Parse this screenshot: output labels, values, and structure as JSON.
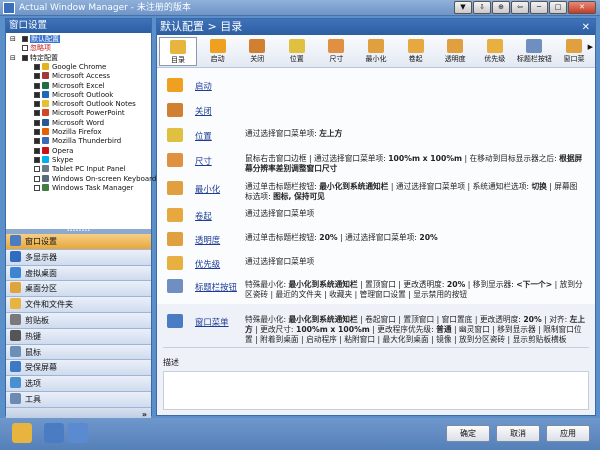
{
  "window": {
    "title": "Actual Window Manager - 未注册的版本",
    "buttons": [
      "▼",
      "⇩",
      "⊕",
      "⇦",
      "─",
      "□",
      "✕"
    ]
  },
  "left": {
    "header": "窗口设置",
    "tree": [
      {
        "label": "默认配置",
        "checked": true,
        "selected": true,
        "indent": 1
      },
      {
        "label": "忽略项",
        "checked": false,
        "indent": 1,
        "red": true
      },
      {
        "label": "特定配置",
        "checked": true,
        "indent": 1
      },
      {
        "label": "Google Chrome",
        "checked": true,
        "indent": 2,
        "color": "#e3b21f"
      },
      {
        "label": "Microsoft Access",
        "checked": true,
        "indent": 2,
        "color": "#a4373a"
      },
      {
        "label": "Microsoft Excel",
        "checked": true,
        "indent": 2,
        "color": "#1d7044"
      },
      {
        "label": "Microsoft Outlook",
        "checked": true,
        "indent": 2,
        "color": "#1b6bb8"
      },
      {
        "label": "Microsoft Outlook Notes",
        "checked": true,
        "indent": 2,
        "color": "#e5c030"
      },
      {
        "label": "Microsoft PowerPoint",
        "checked": true,
        "indent": 2,
        "color": "#d24726"
      },
      {
        "label": "Microsoft Word",
        "checked": true,
        "indent": 2,
        "color": "#2b5797"
      },
      {
        "label": "Mozilla Firefox",
        "checked": true,
        "indent": 2,
        "color": "#e66000"
      },
      {
        "label": "Mozilla Thunderbird",
        "checked": true,
        "indent": 2,
        "color": "#3a6ab5"
      },
      {
        "label": "Opera",
        "checked": true,
        "indent": 2,
        "color": "#cc0f16"
      },
      {
        "label": "Skype",
        "checked": true,
        "indent": 2,
        "color": "#00aff0"
      },
      {
        "label": "Tablet PC Input Panel",
        "checked": false,
        "indent": 2,
        "color": "#6c7a8c"
      },
      {
        "label": "Windows On-screen Keyboard",
        "checked": false,
        "indent": 2,
        "color": "#5a6b7d"
      },
      {
        "label": "Windows Task Manager",
        "checked": false,
        "indent": 2,
        "color": "#3f7f3f"
      }
    ],
    "nav": [
      {
        "label": "窗口设置",
        "active": true,
        "color": "#4a7cc3"
      },
      {
        "label": "多显示器",
        "color": "#2f6bbf"
      },
      {
        "label": "虚拟桌面",
        "color": "#3b86d0"
      },
      {
        "label": "桌面分区",
        "color": "#e0a53a"
      },
      {
        "label": "文件和文件夹",
        "color": "#e6b43f"
      },
      {
        "label": "剪贴板",
        "color": "#7a7a7a"
      },
      {
        "label": "热键",
        "color": "#555555"
      },
      {
        "label": "鼠标",
        "color": "#6c8fb8"
      },
      {
        "label": "受保屏幕",
        "color": "#3d7ac6"
      },
      {
        "label": "选项",
        "color": "#4a8fd0"
      },
      {
        "label": "工具",
        "color": "#6d8ab0"
      }
    ],
    "more": "»"
  },
  "right": {
    "header": "默认配置 > 目录",
    "close": "✕",
    "toolbar": [
      {
        "label": "目录",
        "active": true,
        "color": "#e6b43f"
      },
      {
        "label": "启动",
        "color": "#f0a020"
      },
      {
        "label": "关闭",
        "color": "#d08030"
      },
      {
        "label": "位置",
        "color": "#e0c040"
      },
      {
        "label": "尺寸",
        "color": "#e09040"
      },
      {
        "label": "最小化",
        "color": "#e0a040"
      },
      {
        "label": "卷起",
        "color": "#e8a840"
      },
      {
        "label": "透明度",
        "color": "#e0a040"
      },
      {
        "label": "优先级",
        "color": "#e8b040"
      },
      {
        "label": "标题栏按钮",
        "color": "#6e8fc0"
      },
      {
        "label": "窗口菜",
        "color": "#e0a040"
      }
    ],
    "rows": [
      {
        "link": "启动",
        "desc": "",
        "color": "#f0a020"
      },
      {
        "link": "关闭",
        "desc": "",
        "color": "#d08030"
      },
      {
        "link": "位置",
        "desc": "通过选择窗口菜单项: <b>左上方</b>",
        "color": "#e0c040"
      },
      {
        "link": "尺寸",
        "desc": "鼠标右击窗口边框 | 通过选择窗口菜单项: <b>100%m x 100%m</b> | 在移动到目标显示器之后: <b>根据屏幕分辨率差别调整窗口尺寸</b>",
        "color": "#e09040"
      },
      {
        "link": "最小化",
        "desc": "通过单击标题栏按钮: <b>最小化到系统通知栏</b> | 通过选择窗口菜单项 | 系统通知栏选项: <b>切换</b> | 屏幕图标选项: <b>图标, 保持可见</b>",
        "color": "#e0a040"
      },
      {
        "link": "卷起",
        "desc": "通过选择窗口菜单项",
        "color": "#e8a840"
      },
      {
        "link": "透明度",
        "desc": "通过单击标题栏按钮: <b>20%</b> | 通过选择窗口菜单项: <b>20%</b>",
        "color": "#e0a040"
      },
      {
        "link": "优先级",
        "desc": "通过选择窗口菜单项",
        "color": "#e8b040"
      },
      {
        "link": "标题栏按钮",
        "desc": "特殊最小化: <b>最小化到系统通知栏</b> | 置顶窗口 | 更改透明度: <b>20%</b> | 移到显示器: <b>&lt;下一个&gt;</b> | 放到分区瓷砖 | 最近的文件夹 | 收藏夹 | 管理窗口设置 | 显示禁用的按钮",
        "color": "#6e8fc0"
      },
      {
        "link": "窗口菜单",
        "desc": "特殊最小化: <b>最小化到系统通知栏</b> | 卷起窗口 | 置顶窗口 | 窗口置底 | 更改透明度: <b>20%</b> | 对齐: <b>左上方</b> | 更改尺寸: <b>100%m x 100%m</b> | 更改程序优先级: <b>普通</b> | 幽灵窗口 | 移到显示器 | 限制窗口位置 | 附着到桌面 | 启动程序 | 粘附窗口 | 最大化到桌面 | 镜像 | 放到分区瓷砖 | 显示剪贴板横板",
        "color": "#4a7cc3"
      }
    ],
    "description_label": "描述"
  },
  "bottom": {
    "ok": "确定",
    "cancel": "取消",
    "apply": "应用"
  }
}
